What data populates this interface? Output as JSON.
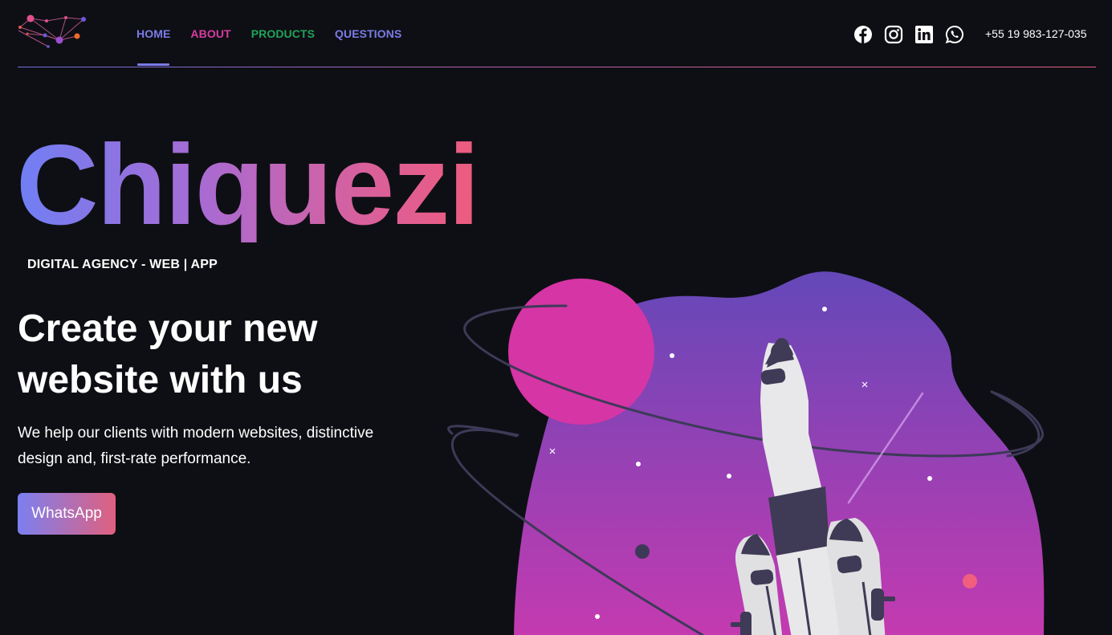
{
  "nav": {
    "items": [
      {
        "label": "HOME",
        "color": "#7b7be8"
      },
      {
        "label": "ABOUT",
        "color": "#d63da0"
      },
      {
        "label": "PRODUCTS",
        "color": "#1fa35a"
      },
      {
        "label": "QUESTIONS",
        "color": "#7b7be8"
      }
    ]
  },
  "social": {
    "icons": [
      "facebook-icon",
      "instagram-icon",
      "linkedin-icon",
      "whatsapp-icon"
    ]
  },
  "contact": {
    "phone": "+55 19 983-127-035"
  },
  "hero": {
    "brand": "Chiquezi",
    "tagline": "DIGITAL AGENCY - WEB | APP",
    "headline": "Create your new website with us",
    "description": "We help our clients with modern websites, distinctive design and, first-rate performance.",
    "cta": "WhatsApp"
  },
  "colors": {
    "background": "#0e0f14",
    "gradient_start": "#6f7ff4",
    "gradient_end": "#ee5b7e",
    "planet": "#d635a5",
    "blob_top": "#6448b8",
    "blob_bottom": "#c63ab0"
  }
}
